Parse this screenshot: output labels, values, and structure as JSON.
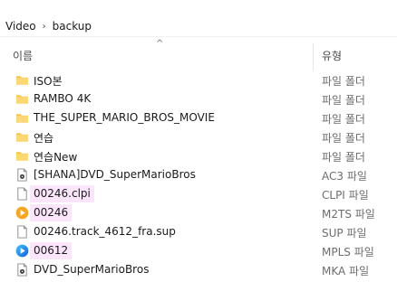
{
  "breadcrumb": {
    "items": [
      "Video",
      "backup"
    ],
    "separator": "›"
  },
  "header": {
    "name_label": "이름",
    "type_label": "유형",
    "sort_glyph": "^"
  },
  "highlight_color": "#fbe5fb",
  "files": [
    {
      "name": "ISO본",
      "type": "파일 폴더",
      "icon": "folder-icon",
      "highlighted": false
    },
    {
      "name": "RAMBO 4K",
      "type": "파일 폴더",
      "icon": "folder-icon",
      "highlighted": false
    },
    {
      "name": "THE_SUPER_MARIO_BROS_MOVIE",
      "type": "파일 폴더",
      "icon": "folder-icon",
      "highlighted": false
    },
    {
      "name": "연습",
      "type": "파일 폴더",
      "icon": "folder-icon",
      "highlighted": false
    },
    {
      "name": "연습New",
      "type": "파일 폴더",
      "icon": "folder-icon",
      "highlighted": false
    },
    {
      "name": "[SHANA]DVD_SuperMarioBros",
      "type": "AC3 파일",
      "icon": "audio-file-icon",
      "highlighted": false
    },
    {
      "name": "00246.clpi",
      "type": "CLPI 파일",
      "icon": "blank-file-icon",
      "highlighted": true
    },
    {
      "name": "00246",
      "type": "M2TS 파일",
      "icon": "media-player-icon",
      "highlighted": true
    },
    {
      "name": "00246.track_4612_fra.sup",
      "type": "SUP 파일",
      "icon": "blank-file-icon",
      "highlighted": false
    },
    {
      "name": "00612",
      "type": "MPLS 파일",
      "icon": "playlist-icon",
      "highlighted": true
    },
    {
      "name": "DVD_SuperMarioBros",
      "type": "MKA 파일",
      "icon": "audio-file-icon",
      "highlighted": false
    }
  ]
}
